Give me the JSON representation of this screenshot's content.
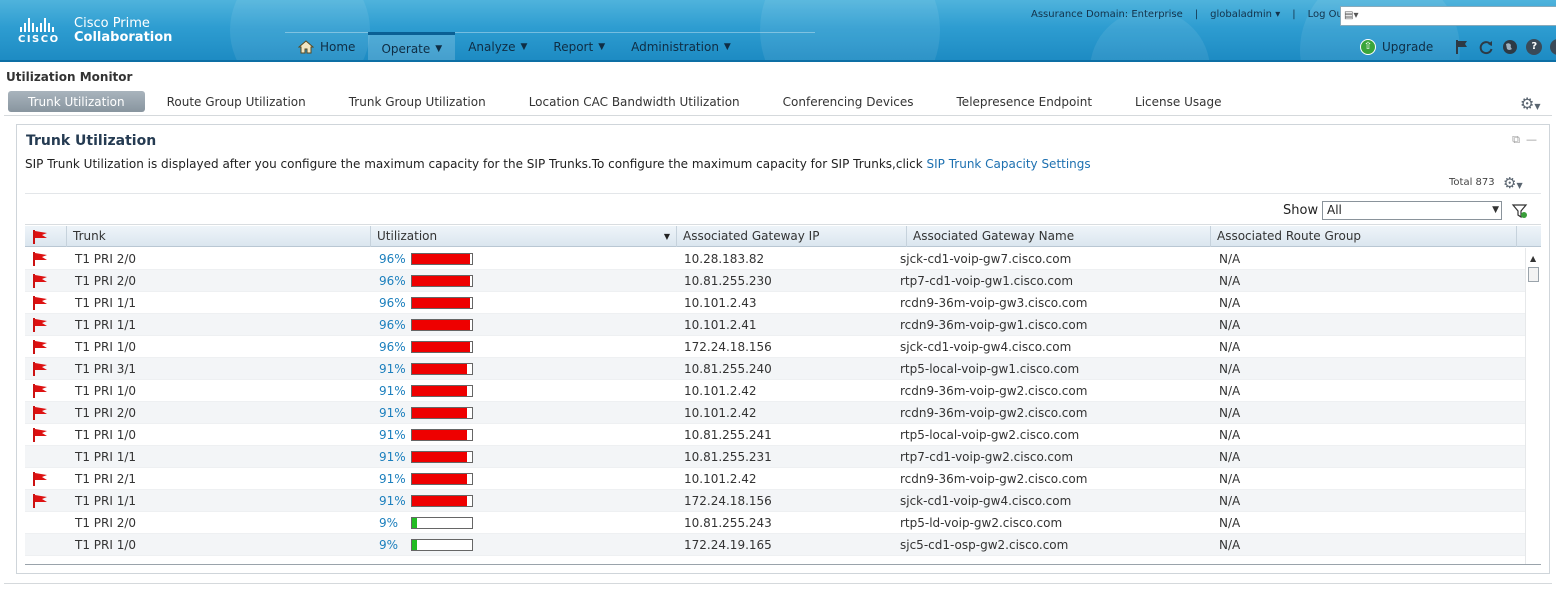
{
  "brand": {
    "logo_text": "CISCO",
    "product_line1": "Cisco Prime",
    "product_line2": "Collaboration"
  },
  "topbar": {
    "assurance_domain": "Assurance Domain: Enterprise",
    "user": "globaladmin",
    "logout": "Log Out",
    "search_placeholder": ""
  },
  "nav": {
    "items": [
      {
        "label": "Home",
        "icon": "home-icon",
        "active": false
      },
      {
        "label": "Operate",
        "active": true
      },
      {
        "label": "Analyze",
        "active": false
      },
      {
        "label": "Report",
        "active": false
      },
      {
        "label": "Administration",
        "active": false
      }
    ]
  },
  "tools": {
    "upgrade": "Upgrade",
    "icons": [
      "flag-icon",
      "refresh-icon",
      "globe-icon",
      "help-icon",
      "info-icon"
    ]
  },
  "page": {
    "title": "Utilization Monitor"
  },
  "tabs": [
    {
      "label": "Trunk Utilization",
      "active": true
    },
    {
      "label": "Route Group Utilization",
      "active": false
    },
    {
      "label": "Trunk Group Utilization",
      "active": false
    },
    {
      "label": "Location CAC Bandwidth Utilization",
      "active": false
    },
    {
      "label": "Conferencing Devices",
      "active": false
    },
    {
      "label": "Telepresence Endpoint",
      "active": false
    },
    {
      "label": "License Usage",
      "active": false
    }
  ],
  "panel": {
    "title": "Trunk Utilization",
    "info_text": "SIP Trunk Utilization is displayed after you configure the maximum capacity for the SIP Trunks.To configure the maximum capacity for SIP Trunks,click ",
    "info_link": "SIP Trunk Capacity Settings",
    "total": "Total 873",
    "show_label": "Show",
    "show_value": "All"
  },
  "colors": {
    "high_util": "#ee0000",
    "low_util": "#22bb22",
    "flag": "#dd1111",
    "link": "#1d70b0"
  },
  "table": {
    "columns": [
      "",
      "Trunk",
      "Utilization",
      "Associated Gateway IP",
      "Associated Gateway Name",
      "Associated Route Group"
    ],
    "rows": [
      {
        "flag": true,
        "trunk": "T1 PRI 2/0",
        "util": "96%",
        "util_value": 0.96,
        "ip": "10.28.183.82",
        "gw": "sjck-cd1-voip-gw7.cisco.com",
        "rg": "N/A"
      },
      {
        "flag": true,
        "trunk": "T1 PRI 2/0",
        "util": "96%",
        "util_value": 0.96,
        "ip": "10.81.255.230",
        "gw": "rtp7-cd1-voip-gw1.cisco.com",
        "rg": "N/A"
      },
      {
        "flag": true,
        "trunk": "T1 PRI 1/1",
        "util": "96%",
        "util_value": 0.96,
        "ip": "10.101.2.43",
        "gw": "rcdn9-36m-voip-gw3.cisco.com",
        "rg": "N/A"
      },
      {
        "flag": true,
        "trunk": "T1 PRI 1/1",
        "util": "96%",
        "util_value": 0.96,
        "ip": "10.101.2.41",
        "gw": "rcdn9-36m-voip-gw1.cisco.com",
        "rg": "N/A"
      },
      {
        "flag": true,
        "trunk": "T1 PRI 1/0",
        "util": "96%",
        "util_value": 0.96,
        "ip": "172.24.18.156",
        "gw": "sjck-cd1-voip-gw4.cisco.com",
        "rg": "N/A"
      },
      {
        "flag": true,
        "trunk": "T1 PRI 3/1",
        "util": "91%",
        "util_value": 0.91,
        "ip": "10.81.255.240",
        "gw": "rtp5-local-voip-gw1.cisco.com",
        "rg": "N/A"
      },
      {
        "flag": true,
        "trunk": "T1 PRI 1/0",
        "util": "91%",
        "util_value": 0.91,
        "ip": "10.101.2.42",
        "gw": "rcdn9-36m-voip-gw2.cisco.com",
        "rg": "N/A"
      },
      {
        "flag": true,
        "trunk": "T1 PRI 2/0",
        "util": "91%",
        "util_value": 0.91,
        "ip": "10.101.2.42",
        "gw": "rcdn9-36m-voip-gw2.cisco.com",
        "rg": "N/A"
      },
      {
        "flag": true,
        "trunk": "T1 PRI 1/0",
        "util": "91%",
        "util_value": 0.91,
        "ip": "10.81.255.241",
        "gw": "rtp5-local-voip-gw2.cisco.com",
        "rg": "N/A"
      },
      {
        "flag": false,
        "trunk": "T1 PRI 1/1",
        "util": "91%",
        "util_value": 0.91,
        "ip": "10.81.255.231",
        "gw": "rtp7-cd1-voip-gw2.cisco.com",
        "rg": "N/A"
      },
      {
        "flag": true,
        "trunk": "T1 PRI 2/1",
        "util": "91%",
        "util_value": 0.91,
        "ip": "10.101.2.42",
        "gw": "rcdn9-36m-voip-gw2.cisco.com",
        "rg": "N/A"
      },
      {
        "flag": true,
        "trunk": "T1 PRI 1/1",
        "util": "91%",
        "util_value": 0.91,
        "ip": "172.24.18.156",
        "gw": "sjck-cd1-voip-gw4.cisco.com",
        "rg": "N/A"
      },
      {
        "flag": false,
        "trunk": "T1 PRI 2/0",
        "util": "9%",
        "util_value": 0.09,
        "ip": "10.81.255.243",
        "gw": "rtp5-ld-voip-gw2.cisco.com",
        "rg": "N/A"
      },
      {
        "flag": false,
        "trunk": "T1 PRI 1/0",
        "util": "9%",
        "util_value": 0.09,
        "ip": "172.24.19.165",
        "gw": "sjc5-cd1-osp-gw2.cisco.com",
        "rg": "N/A"
      }
    ]
  }
}
